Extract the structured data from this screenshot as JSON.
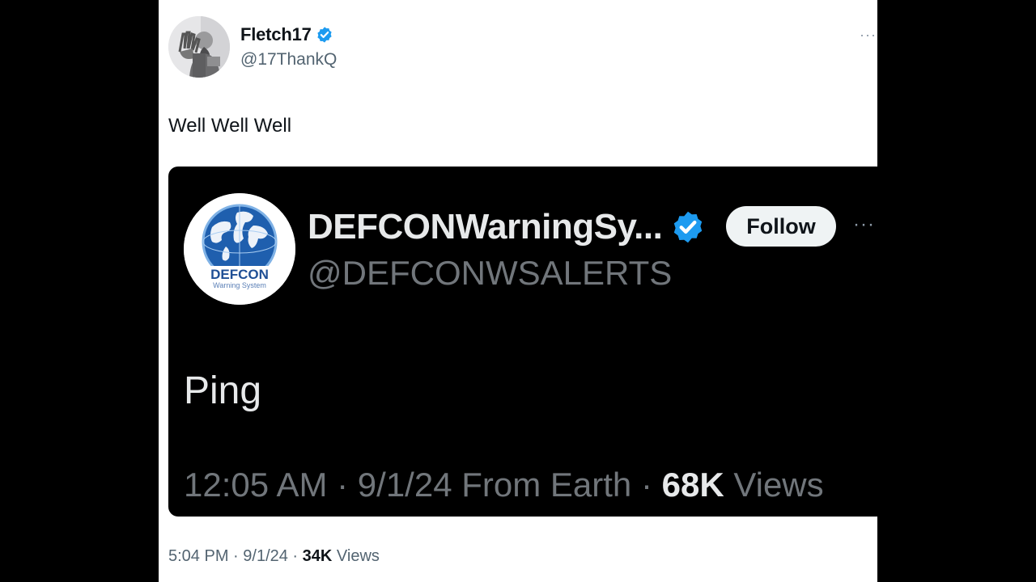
{
  "tweet": {
    "author": {
      "name": "Fletch17",
      "handle": "@17ThankQ",
      "verified": true,
      "avatar_icon": "user-avatar-icon"
    },
    "more_label": "···",
    "text": "Well Well Well",
    "meta": {
      "time": "5:04 PM",
      "sep1": " · ",
      "date": "9/1/24",
      "sep2": " · ",
      "views_count": "34K",
      "views_label": " Views"
    }
  },
  "quoted_tweet": {
    "author": {
      "name": "DEFCONWarningSy...",
      "handle": "@DEFCONWSALERTS",
      "verified": true,
      "logo_text": "DEFCON",
      "logo_subtext": "Warning System"
    },
    "follow_label": "Follow",
    "more_label": "···",
    "text": "Ping",
    "meta": {
      "time": "12:05 AM",
      "sep1": " · ",
      "date": "9/1/24",
      "source": " From Earth",
      "sep2": " · ",
      "views_count": "68K",
      "views_label": " Views"
    }
  },
  "colors": {
    "verified": "#1d9bf0",
    "panel_bg": "#ffffff",
    "quote_bg": "#000000",
    "text_primary_light": "#0f1419",
    "text_secondary_light": "#536471",
    "text_primary_dark": "#e7e9ea",
    "text_secondary_dark": "#71767b"
  }
}
